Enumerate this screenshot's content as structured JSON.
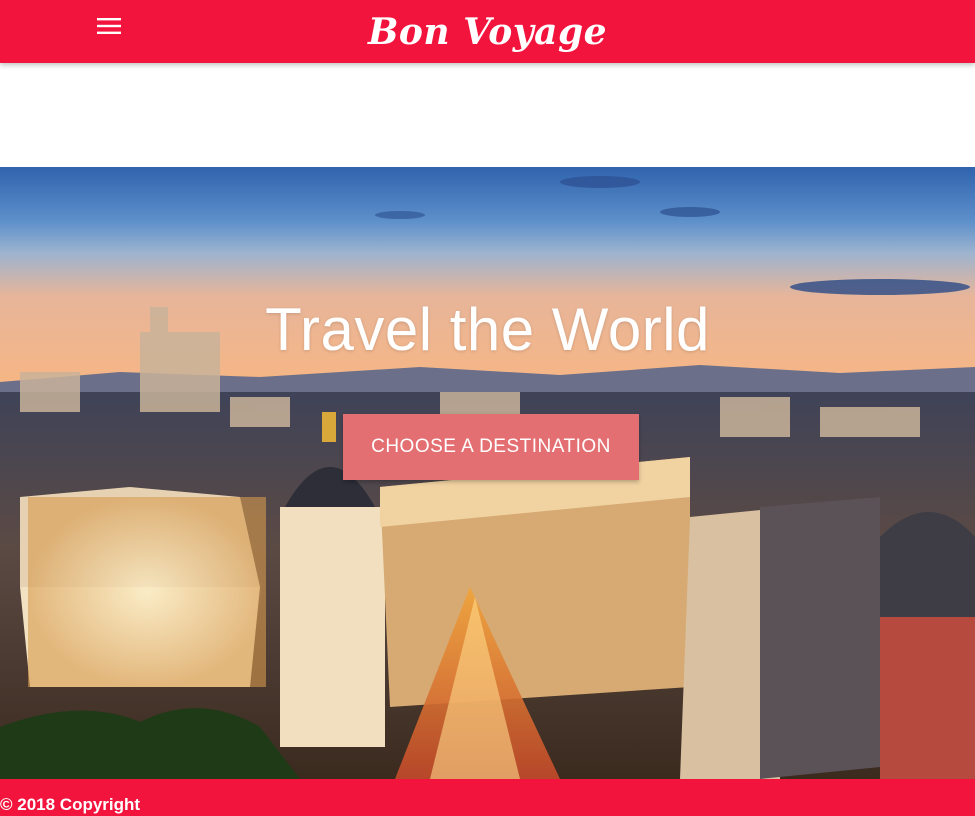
{
  "colors": {
    "brand": "#f2143d",
    "cta": "#e46f72",
    "text_on_brand": "#ffffff"
  },
  "navbar": {
    "brand": "Bon Voyage",
    "menu_icon": "hamburger-menu-icon"
  },
  "hero": {
    "title": "Travel the World",
    "cta_label": "CHOOSE A DESTINATION"
  },
  "footer": {
    "copyright": "© 2018 Copyright"
  }
}
